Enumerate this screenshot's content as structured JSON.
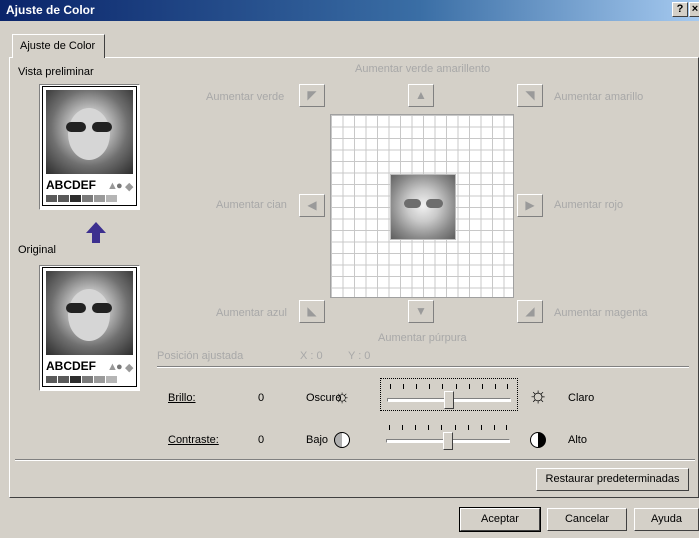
{
  "window": {
    "title": "Ajuste de Color",
    "help_label": "?",
    "close_label": "×"
  },
  "tab": {
    "label": "Ajuste de Color"
  },
  "preview": {
    "label_preview": "Vista preliminar",
    "label_original": "Original",
    "thumb_text": "ABCDEF",
    "swatches": [
      "#5a5a5a",
      "#5a5a5a",
      "#2d2d2d",
      "#7a7a7a",
      "#9a9a9a",
      "#b5b5b5"
    ],
    "arrow_color": "#3c2f8f"
  },
  "color_adjust": {
    "increase_yellow_green": "Aumentar verde amarillento",
    "increase_green": "Aumentar verde",
    "increase_yellow": "Aumentar amarillo",
    "increase_cyan": "Aumentar cian",
    "increase_red": "Aumentar rojo",
    "increase_blue": "Aumentar azul",
    "increase_magenta": "Aumentar magenta",
    "increase_purple": "Aumentar púrpura",
    "adjusted_position_label": "Posición ajustada",
    "x_label": "X : 0",
    "y_label": "Y : 0"
  },
  "brightness": {
    "label": "Brillo:",
    "value": "0",
    "low_label": "Oscuro",
    "high_label": "Claro",
    "level": 0.5
  },
  "contrast": {
    "label": "Contraste:",
    "value": "0",
    "low_label": "Bajo",
    "high_label": "Alto",
    "level": 0.5
  },
  "buttons": {
    "restore_defaults": "Restaurar predeterminadas",
    "accept": "Aceptar",
    "cancel": "Cancelar",
    "help": "Ayuda"
  }
}
